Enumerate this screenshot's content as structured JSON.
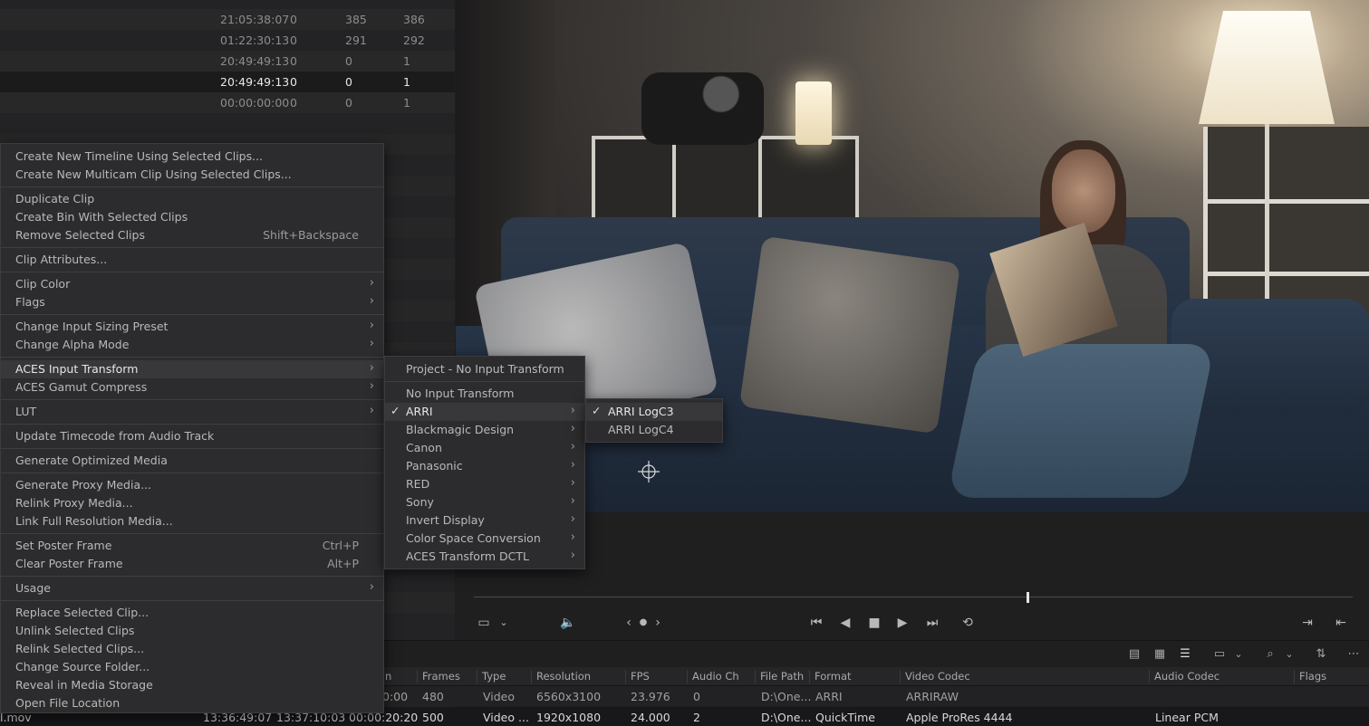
{
  "bin_rows": [
    {
      "tc": "21:05:38:07",
      "c1": "0",
      "c2": "385",
      "c3": "386"
    },
    {
      "tc": "01:22:30:13",
      "c1": "0",
      "c2": "291",
      "c3": "292"
    },
    {
      "tc": "20:49:49:13",
      "c1": "0",
      "c2": "0",
      "c3": "1"
    },
    {
      "tc": "20:49:49:13",
      "c1": "0",
      "c2": "0",
      "c3": "1"
    },
    {
      "tc": "00:00:00:00",
      "c1": "0",
      "c2": "0",
      "c3": "1"
    }
  ],
  "context_menu": {
    "items": [
      {
        "label": "Create New Timeline Using Selected Clips..."
      },
      {
        "label": "Create New Multicam Clip Using Selected Clips..."
      },
      {
        "label": "Duplicate Clip"
      },
      {
        "label": "Create Bin With Selected Clips"
      },
      {
        "label": "Remove Selected Clips",
        "shortcut": "Shift+Backspace"
      },
      {
        "label": "Clip Attributes..."
      },
      {
        "label": "Clip Color",
        "arrow": "›"
      },
      {
        "label": "Flags",
        "arrow": "›"
      },
      {
        "label": "Change Input Sizing Preset",
        "arrow": "›"
      },
      {
        "label": "Change Alpha Mode",
        "arrow": "›"
      },
      {
        "label": "ACES Input Transform",
        "arrow": "›"
      },
      {
        "label": "ACES Gamut Compress",
        "arrow": "›"
      },
      {
        "label": "LUT",
        "arrow": "›"
      },
      {
        "label": "Update Timecode from Audio Track"
      },
      {
        "label": "Generate Optimized Media"
      },
      {
        "label": "Generate Proxy Media..."
      },
      {
        "label": "Relink Proxy Media..."
      },
      {
        "label": "Link Full Resolution Media..."
      },
      {
        "label": "Set Poster Frame",
        "shortcut": "Ctrl+P"
      },
      {
        "label": "Clear Poster Frame",
        "shortcut": "Alt+P"
      },
      {
        "label": "Usage",
        "arrow": "›"
      },
      {
        "label": "Replace Selected Clip..."
      },
      {
        "label": "Unlink Selected Clips"
      },
      {
        "label": "Relink Selected Clips..."
      },
      {
        "label": "Change Source Folder..."
      },
      {
        "label": "Reveal in Media Storage"
      },
      {
        "label": "Open File Location"
      }
    ]
  },
  "aces_submenu": {
    "items": [
      {
        "label": "Project - No Input Transform"
      },
      {
        "label": "No Input Transform"
      },
      {
        "label": "ARRI",
        "arrow": "›",
        "check": "✓"
      },
      {
        "label": "Blackmagic Design",
        "arrow": "›"
      },
      {
        "label": "Canon",
        "arrow": "›"
      },
      {
        "label": "Panasonic",
        "arrow": "›"
      },
      {
        "label": "RED",
        "arrow": "›"
      },
      {
        "label": "Sony",
        "arrow": "›"
      },
      {
        "label": "Invert Display",
        "arrow": "›"
      },
      {
        "label": "Color Space Conversion",
        "arrow": "›"
      },
      {
        "label": "ACES Transform DCTL",
        "arrow": "›"
      }
    ]
  },
  "arri_submenu": {
    "items": [
      {
        "label": "ARRI LogC3",
        "check": "✓"
      },
      {
        "label": "ARRI LogC4"
      }
    ]
  },
  "viewer": {
    "scrub_position": 0.63
  },
  "list_columns": [
    "n",
    "Frames",
    "Type",
    "Resolution",
    "FPS",
    "Audio Ch",
    "File Path",
    "Format",
    "Video Codec",
    "Audio Codec",
    "Flags"
  ],
  "list_rows": [
    {
      "name": "",
      "start": "",
      "end": "",
      "duration": "0:00",
      "frames": "480",
      "type": "Video",
      "resolution": "6560x3100",
      "fps": "23.976",
      "audio_ch": "0",
      "file_path": "D:\\One...",
      "format": "ARRI",
      "video_codec": "ARRIRAW",
      "audio_codec": ""
    },
    {
      "name": "l.mov",
      "start": "13:36:49:07",
      "end": "13:37:10:03",
      "duration": "00:00:20:20",
      "frames": "500",
      "type": "Video ...",
      "resolution": "1920x1080",
      "fps": "24.000",
      "audio_ch": "2",
      "file_path": "D:\\One...",
      "format": "QuickTime",
      "video_codec": "Apple ProRes 4444",
      "audio_codec": "Linear PCM"
    }
  ]
}
